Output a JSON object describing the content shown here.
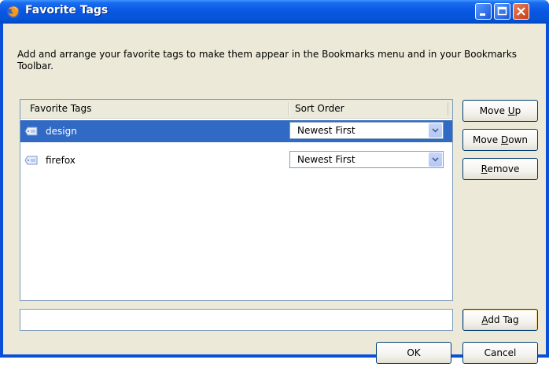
{
  "window": {
    "title": "Favorite Tags"
  },
  "description": "Add and arrange your favorite tags to make them appear in the Bookmarks menu and in your Bookmarks Toolbar.",
  "list": {
    "columns": [
      "Favorite Tags",
      "Sort Order"
    ],
    "rows": [
      {
        "tag": "design",
        "sort": "Newest First",
        "selected": true
      },
      {
        "tag": "firefox",
        "sort": "Newest First",
        "selected": false
      }
    ]
  },
  "buttons": {
    "move_up": {
      "pre": "Move ",
      "u": "U",
      "post": "p"
    },
    "move_down": {
      "pre": "Move ",
      "u": "D",
      "post": "own"
    },
    "remove": {
      "pre": "",
      "u": "R",
      "post": "emove"
    },
    "add_tag": {
      "pre": "",
      "u": "A",
      "post": "dd Tag"
    },
    "ok": "OK",
    "cancel": "Cancel"
  },
  "add_tag_input": {
    "value": ""
  },
  "colors": {
    "titlebar": "#0a58e3",
    "selection": "#316ac5",
    "dialog_bg": "#ece9d8"
  }
}
